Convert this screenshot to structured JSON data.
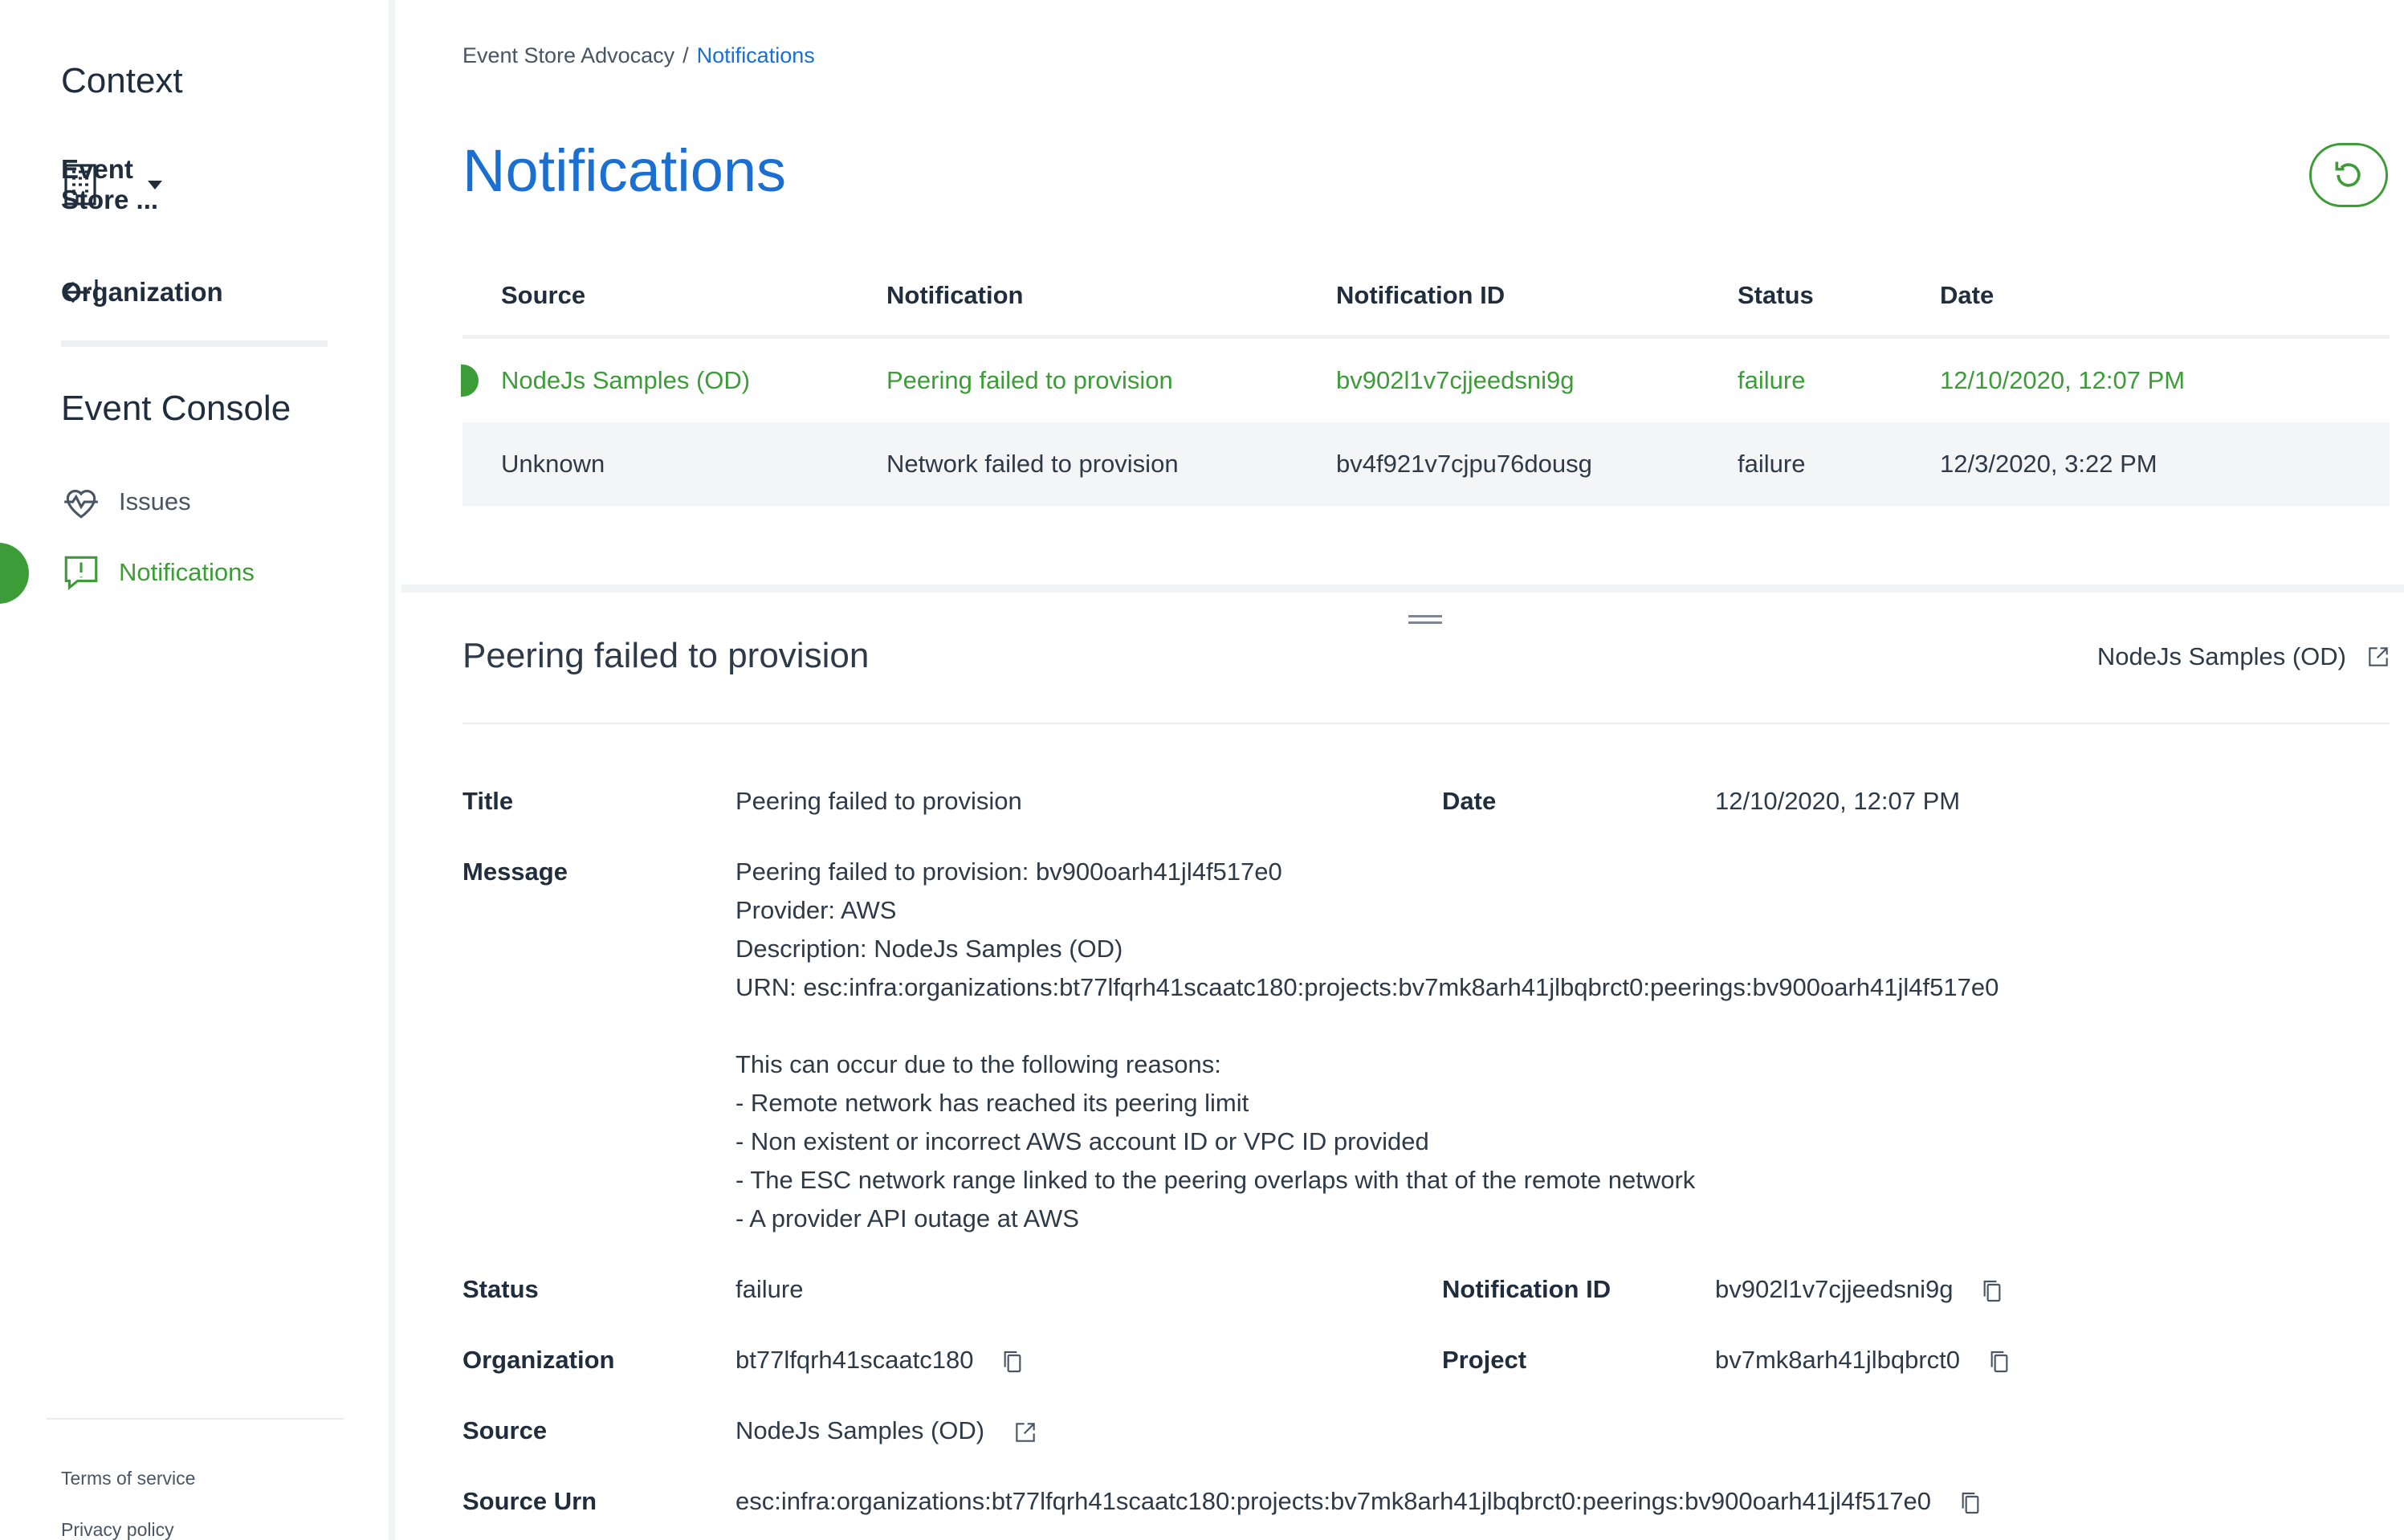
{
  "sidebar": {
    "context_title": "Context",
    "context_select": "Event Store ...",
    "organization_link": "Organization",
    "section_title": "Event Console",
    "nav": [
      {
        "label": "Issues",
        "icon": "heartbeat-icon"
      },
      {
        "label": "Notifications",
        "icon": "alert-message-icon",
        "active": true
      }
    ],
    "footer": {
      "terms": "Terms of service",
      "privacy": "Privacy policy"
    }
  },
  "breadcrumb": {
    "parent": "Event Store Advocacy",
    "separator": "/",
    "current": "Notifications"
  },
  "page_title": "Notifications",
  "table": {
    "columns": [
      "Source",
      "Notification",
      "Notification ID",
      "Status",
      "Date"
    ],
    "rows": [
      {
        "source": "NodeJs Samples (OD)",
        "notification": "Peering failed to provision",
        "id": "bv902l1v7cjjeedsni9g",
        "status": "failure",
        "date": "12/10/2020, 12:07 PM",
        "selected": true
      },
      {
        "source": "Unknown",
        "notification": "Network failed to provision",
        "id": "bv4f921v7cjpu76dousg",
        "status": "failure",
        "date": "12/3/2020, 3:22 PM",
        "selected": false
      }
    ]
  },
  "detail": {
    "title": "Peering failed to provision",
    "source_link": "NodeJs Samples (OD)",
    "labels": {
      "title": "Title",
      "date": "Date",
      "message": "Message",
      "status": "Status",
      "notification_id": "Notification ID",
      "organization": "Organization",
      "project": "Project",
      "source": "Source",
      "source_urn": "Source Urn"
    },
    "values": {
      "title": "Peering failed to provision",
      "date": "12/10/2020, 12:07 PM",
      "message": "Peering failed to provision: bv900oarh41jl4f517e0\nProvider: AWS\nDescription: NodeJs Samples (OD)\nURN: esc:infra:organizations:bt77lfqrh41scaatc180:projects:bv7mk8arh41jlbqbrct0:peerings:bv900oarh41jl4f517e0\n\nThis can occur due to the following reasons:\n- Remote network has reached its peering limit\n- Non existent or incorrect AWS account ID or VPC ID provided\n- The ESC network range linked to the peering overlaps with that of the remote network\n- A provider API outage at AWS",
      "status": "failure",
      "notification_id": "bv902l1v7cjjeedsni9g",
      "organization": "bt77lfqrh41scaatc180",
      "project": "bv7mk8arh41jlbqbrct0",
      "source": "NodeJs Samples (OD)",
      "source_urn": "esc:infra:organizations:bt77lfqrh41scaatc180:projects:bv7mk8arh41jlbqbrct0:peerings:bv900oarh41jl4f517e0"
    }
  },
  "colors": {
    "accent_green": "#3c9d38",
    "accent_blue": "#1a6fd1",
    "text": "#1f2d3d"
  }
}
